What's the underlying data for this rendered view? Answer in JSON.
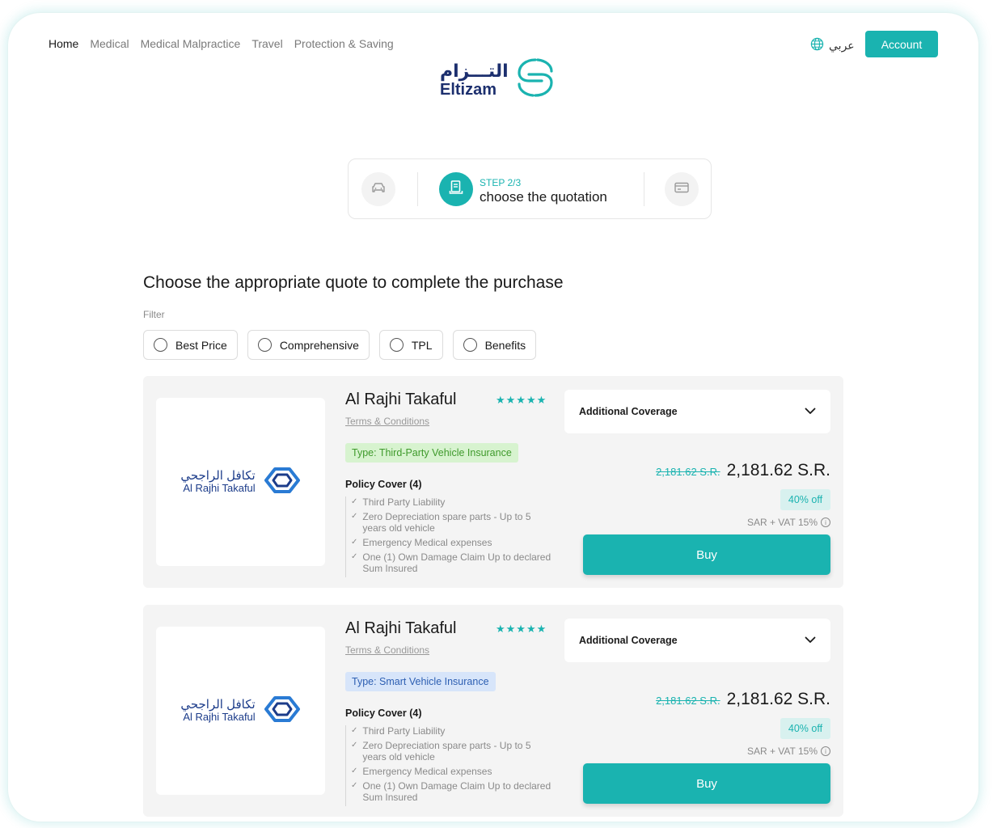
{
  "nav": {
    "items": [
      {
        "label": "Home",
        "active": true
      },
      {
        "label": "Medical",
        "active": false
      },
      {
        "label": "Medical Malpractice",
        "active": false
      },
      {
        "label": "Travel",
        "active": false
      },
      {
        "label": "Protection & Saving",
        "active": false
      }
    ],
    "language_label": "عربي",
    "account_label": "Account"
  },
  "brand": {
    "name_ar": "التـــزام",
    "name_en": "Eltizam"
  },
  "stepper": {
    "step_label": "STEP 2/3",
    "step_title": "choose the quotation"
  },
  "page": {
    "heading": "Choose the appropriate quote to complete the purchase",
    "filter_label": "Filter"
  },
  "filters": [
    "Best Price",
    "Comprehensive",
    "TPL",
    "Benefits"
  ],
  "colors": {
    "accent": "#1ab3b0",
    "brand_navy": "#1c2f6e"
  },
  "quotes": [
    {
      "insurer": "Al Rajhi Takaful",
      "logo_ar": "تكافل الراجحي",
      "logo_en": "Al Rajhi Takaful",
      "rating": "★★★★★",
      "terms_label": "Terms & Conditions",
      "type_label": "Type: Third-Party Vehicle Insurance",
      "policy_title": "Policy Cover (4)",
      "policy_items": [
        "Third Party Liability",
        "Zero Depreciation spare parts - Up to 5 years old vehicle",
        "Emergency Medical expenses",
        "One (1) Own Damage Claim Up to declared Sum Insured"
      ],
      "additional_coverage": "Additional Coverage",
      "old_price": "2,181.62 S.R.",
      "new_price": "2,181.62 S.R.",
      "discount": "40% off",
      "vat_note": "SAR + VAT 15%",
      "buy_label": "Buy"
    },
    {
      "insurer": "Al Rajhi Takaful",
      "logo_ar": "تكافل الراجحي",
      "logo_en": "Al Rajhi Takaful",
      "rating": "★★★★★",
      "terms_label": "Terms & Conditions",
      "type_label": "Type: Smart Vehicle Insurance",
      "policy_title": "Policy Cover (4)",
      "policy_items": [
        "Third Party Liability",
        "Zero Depreciation spare parts - Up to 5 years old vehicle",
        "Emergency Medical expenses",
        "One (1) Own Damage Claim Up to declared Sum Insured"
      ],
      "additional_coverage": "Additional Coverage",
      "old_price": "2,181.62 S.R.",
      "new_price": "2,181.62 S.R.",
      "discount": "40% off",
      "vat_note": "SAR + VAT 15%",
      "buy_label": "Buy"
    }
  ]
}
